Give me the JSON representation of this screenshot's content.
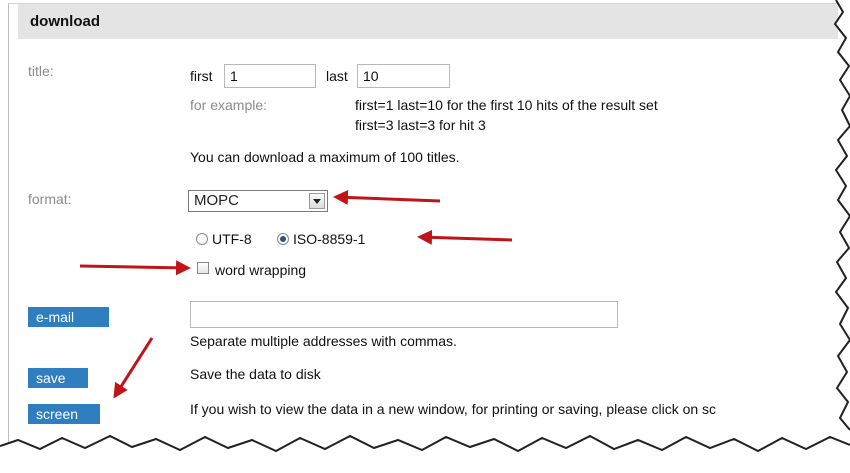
{
  "header": {
    "title": "download"
  },
  "title_row": {
    "label": "title:",
    "first_label": "first",
    "first_value": "1",
    "last_label": "last",
    "last_value": "10",
    "example_label": "for example:",
    "example_line1": "first=1 last=10 for the first 10 hits of the result set",
    "example_line2": "first=3 last=3 for hit 3",
    "max_note": "You can download a maximum of 100 titles."
  },
  "format_row": {
    "label": "format:",
    "selected_format": "MOPC",
    "encoding_options": [
      "UTF-8",
      "ISO-8859-1"
    ],
    "selected_encoding": "ISO-8859-1",
    "word_wrapping_label": "word wrapping",
    "word_wrapping_checked": false
  },
  "email_row": {
    "button_label": "e-mail",
    "input_value": "",
    "note": "Separate multiple addresses with commas."
  },
  "save_row": {
    "button_label": "save",
    "description": "Save the data to disk"
  },
  "screen_row": {
    "button_label": "screen",
    "description": "If you wish to view the data in a new window, for printing or saving, please click on sc"
  },
  "colors": {
    "button": "#2f7fc0",
    "arrow": "#c0141a",
    "label": "#8c8c8c",
    "header": "#e4e4e4"
  }
}
